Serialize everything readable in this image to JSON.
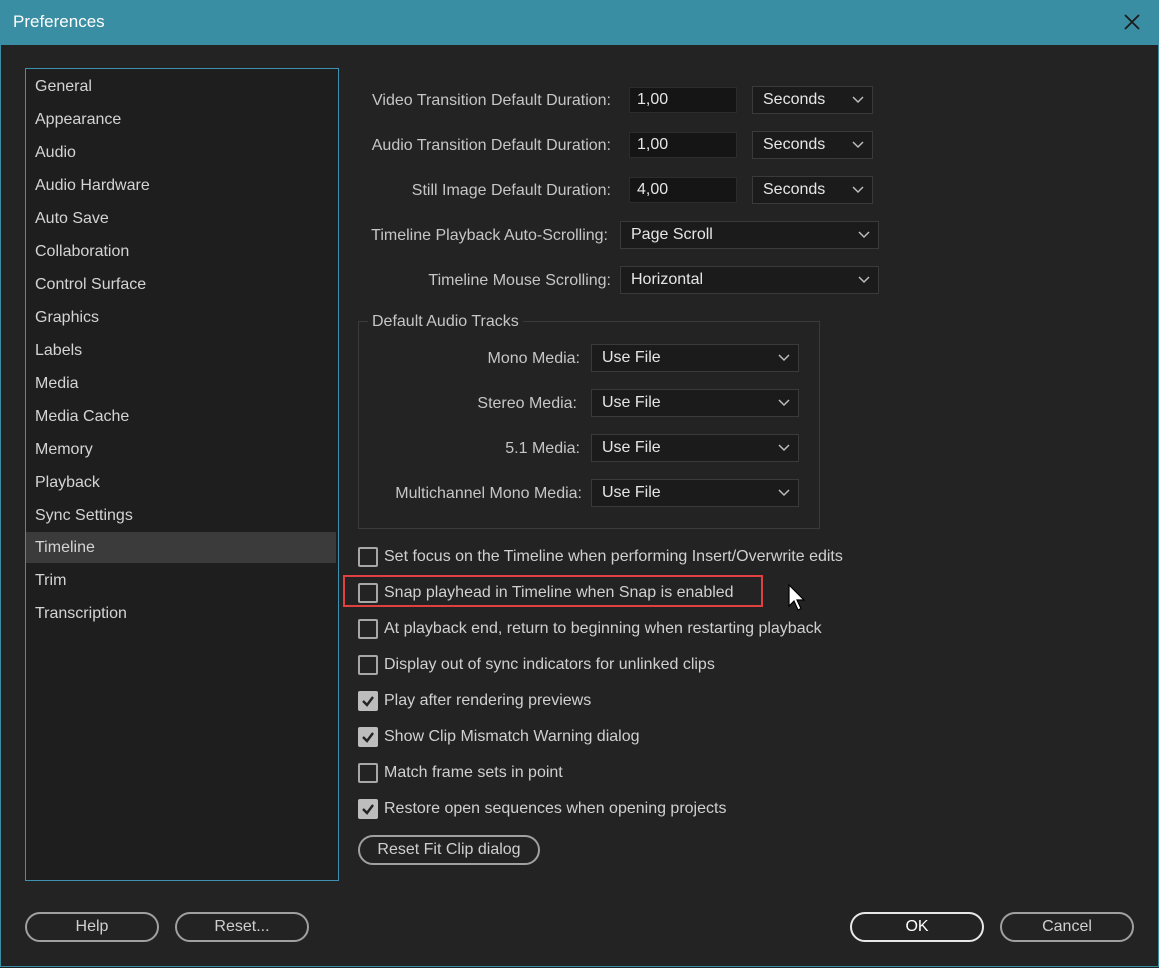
{
  "window": {
    "title": "Preferences"
  },
  "sidebar": {
    "items": [
      {
        "label": "General"
      },
      {
        "label": "Appearance"
      },
      {
        "label": "Audio"
      },
      {
        "label": "Audio Hardware"
      },
      {
        "label": "Auto Save"
      },
      {
        "label": "Collaboration"
      },
      {
        "label": "Control Surface"
      },
      {
        "label": "Graphics"
      },
      {
        "label": "Labels"
      },
      {
        "label": "Media"
      },
      {
        "label": "Media Cache"
      },
      {
        "label": "Memory"
      },
      {
        "label": "Playback"
      },
      {
        "label": "Sync Settings"
      },
      {
        "label": "Timeline"
      },
      {
        "label": "Trim"
      },
      {
        "label": "Transcription"
      }
    ],
    "selected": "Timeline"
  },
  "durations": {
    "video": {
      "label": "Video Transition Default Duration:",
      "value": "1,00",
      "unit": "Seconds"
    },
    "audio": {
      "label": "Audio Transition Default Duration:",
      "value": "1,00",
      "unit": "Seconds"
    },
    "still": {
      "label": "Still Image Default Duration:",
      "value": "4,00",
      "unit": "Seconds"
    }
  },
  "scrolling": {
    "playback": {
      "label": "Timeline Playback Auto-Scrolling:",
      "value": "Page Scroll"
    },
    "mouse": {
      "label": "Timeline Mouse Scrolling:",
      "value": "Horizontal"
    }
  },
  "audio_tracks": {
    "title": "Default Audio Tracks",
    "mono": {
      "label": "Mono Media:",
      "value": "Use File"
    },
    "stereo": {
      "label": "Stereo Media:",
      "value": "Use File"
    },
    "five_one": {
      "label": "5.1 Media:",
      "value": "Use File"
    },
    "multichannel": {
      "label": "Multichannel Mono Media:",
      "value": "Use File"
    }
  },
  "checkboxes": [
    {
      "label": "Set focus on the Timeline when performing Insert/Overwrite edits",
      "checked": false
    },
    {
      "label": "Snap playhead in Timeline when Snap is enabled",
      "checked": false
    },
    {
      "label": "At playback end, return to beginning when restarting playback",
      "checked": false
    },
    {
      "label": "Display out of sync indicators for unlinked clips",
      "checked": false
    },
    {
      "label": "Play after rendering previews",
      "checked": true
    },
    {
      "label": "Show Clip Mismatch Warning dialog",
      "checked": true
    },
    {
      "label": "Match frame sets in point",
      "checked": false
    },
    {
      "label": "Restore open sequences when opening projects",
      "checked": true
    }
  ],
  "buttons": {
    "reset_fit_clip": "Reset Fit Clip dialog",
    "help": "Help",
    "reset": "Reset...",
    "ok": "OK",
    "cancel": "Cancel"
  },
  "colors": {
    "titlebar": "#3a8ea3",
    "highlight": "#e04040",
    "background": "#232323"
  }
}
